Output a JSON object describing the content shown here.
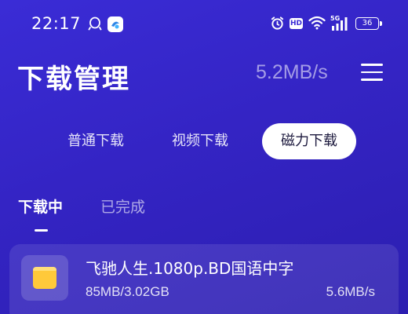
{
  "status_bar": {
    "time": "22:17",
    "hd_label": "HD",
    "network_label": "5G",
    "battery_level": "36",
    "icons": [
      "qq-icon",
      "app-badge-icon",
      "alarm-icon",
      "wifi-icon",
      "signal-icon",
      "battery-icon"
    ]
  },
  "header": {
    "title": "下载管理",
    "total_speed": "5.2MB/s",
    "menu_icon": "menu-icon"
  },
  "category_tabs": [
    {
      "label": "普通下载",
      "active": false
    },
    {
      "label": "视频下载",
      "active": false
    },
    {
      "label": "磁力下载",
      "active": true
    }
  ],
  "status_tabs": [
    {
      "label": "下载中",
      "active": true
    },
    {
      "label": "已完成",
      "active": false
    }
  ],
  "downloads": [
    {
      "name": "飞驰人生.1080p.BD国语中字",
      "progress": "85MB/3.02GB",
      "speed": "5.6MB/s",
      "icon": "folder-icon"
    }
  ],
  "colors": {
    "background": "#3a2cd6",
    "active_tab_bg": "#ffffff",
    "folder": "#ffc93a"
  }
}
